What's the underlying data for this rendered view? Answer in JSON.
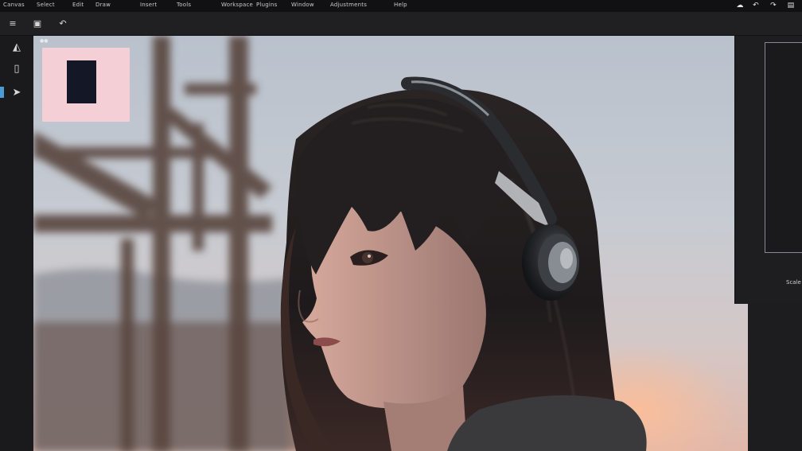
{
  "menubar": {
    "items": [
      "Canvas",
      "Select",
      "Edit",
      "Draw",
      "Insert",
      "Tools",
      "Workspace",
      "Plugins",
      "Window",
      "Adjustments",
      "Help"
    ],
    "right_icons": [
      "cloud-icon",
      "undo-icon",
      "redo-icon",
      "layers-icon"
    ]
  },
  "toolbar": {
    "icons": [
      "menu-icon",
      "shape-icon",
      "curve-icon"
    ]
  },
  "rail": {
    "tools": [
      "brush-icon",
      "document-icon",
      "cursor-icon"
    ]
  },
  "right_panel": {
    "label": "Scale"
  },
  "colors": {
    "swatch_outer": "#f4cfd6",
    "swatch_inner": "#141826",
    "accent": "#4b9bd6"
  }
}
